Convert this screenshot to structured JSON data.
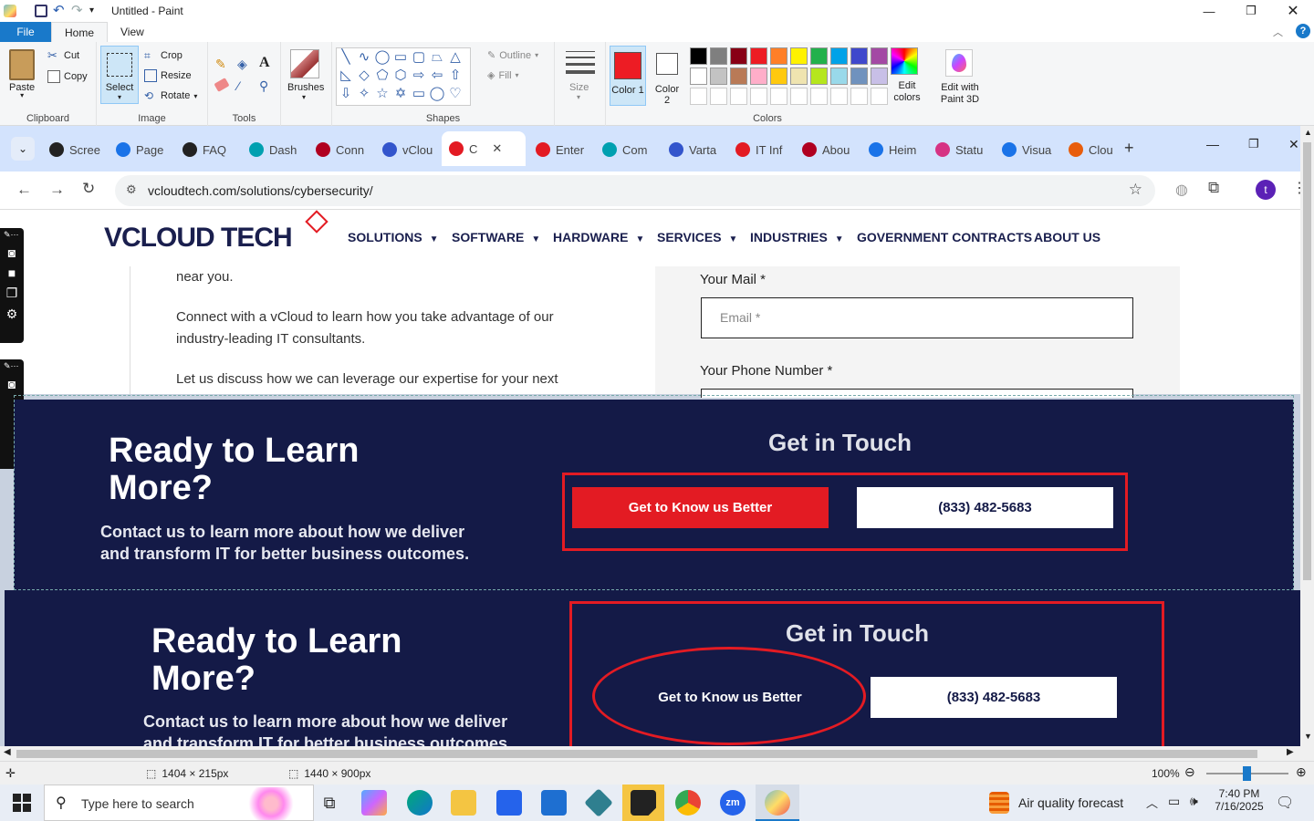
{
  "paint": {
    "window_title": "Untitled - Paint",
    "menu": {
      "file": "File",
      "home": "Home",
      "view": "View"
    },
    "clipboard": {
      "paste": "Paste",
      "cut": "Cut",
      "copy": "Copy",
      "label": "Clipboard"
    },
    "image": {
      "select": "Select",
      "crop": "Crop",
      "resize": "Resize",
      "rotate": "Rotate",
      "label": "Image"
    },
    "tools": {
      "label": "Tools"
    },
    "brushes": {
      "label": "Brushes"
    },
    "shapes": {
      "outline": "Outline",
      "fill": "Fill",
      "label": "Shapes"
    },
    "size": {
      "label": "Size"
    },
    "colors": {
      "color1": "Color 1",
      "color2": "Color 2",
      "edit_colors": "Edit colors",
      "edit_with_paint3d": "Edit with Paint 3D",
      "label": "Colors",
      "color1_value": "#ed1c24",
      "color2_value": "#ffffff",
      "palette_row1": [
        "#000000",
        "#7f7f7f",
        "#880015",
        "#ed1c24",
        "#ff7f27",
        "#fff200",
        "#22b14c",
        "#00a2e8",
        "#3f48cc",
        "#a349a4"
      ],
      "palette_row2": [
        "#ffffff",
        "#c3c3c3",
        "#b97a57",
        "#ffaec9",
        "#ffc90e",
        "#efe4b0",
        "#b5e61d",
        "#99d9ea",
        "#7092be",
        "#c8bfe7"
      ]
    },
    "status": {
      "selection_size": "1404 × 215px",
      "canvas_size": "1440 × 900px",
      "zoom": "100%"
    }
  },
  "browser": {
    "tabs": [
      {
        "label": "Scree",
        "color": "#222"
      },
      {
        "label": "Page",
        "color": "#1a73e8"
      },
      {
        "label": "FAQ",
        "color": "#222"
      },
      {
        "label": "Dash",
        "color": "#00a0b0"
      },
      {
        "label": "Conn",
        "color": "#b00020"
      },
      {
        "label": "vClou",
        "color": "#3355cc"
      },
      {
        "label": "C",
        "color": "#e31b23",
        "active": true
      },
      {
        "label": "Enter",
        "color": "#e31b23"
      },
      {
        "label": "Com",
        "color": "#00a0b0"
      },
      {
        "label": "Varta",
        "color": "#3355cc"
      },
      {
        "label": "IT Inf",
        "color": "#e31b23"
      },
      {
        "label": "Abou",
        "color": "#b00020"
      },
      {
        "label": "Heim",
        "color": "#1a73e8"
      },
      {
        "label": "Statu",
        "color": "#d63384"
      },
      {
        "label": "Visua",
        "color": "#1a73e8"
      },
      {
        "label": "Clou",
        "color": "#e85d0c"
      }
    ],
    "url": "vcloudtech.com/solutions/cybersecurity/",
    "profile_initial": "t"
  },
  "site": {
    "logo_text": "VCLOUD TECH",
    "nav": [
      "SOLUTIONS",
      "SOFTWARE",
      "HARDWARE",
      "SERVICES",
      "INDUSTRIES",
      "GOVERNMENT CONTRACTS",
      "ABOUT US"
    ],
    "para_lines": [
      "near you.",
      "Connect with a vCloud to learn how you take advantage of our",
      "industry-leading IT consultants.",
      "Let us discuss how we can leverage our expertise for your next"
    ],
    "form": {
      "mail_label": "Your Mail *",
      "mail_placeholder": "Email *",
      "phone_label": "Your Phone Number *"
    }
  },
  "cta": {
    "heading_line1": "Ready to Learn",
    "heading_line2": "More?",
    "sub_line1": "Contact us to learn more about how we deliver",
    "sub_line2": "and transform IT for better business outcomes.",
    "get_in_touch": "Get in Touch",
    "know_button": "Get to Know us Better",
    "phone_button": "(833) 482-5683"
  },
  "taskbar": {
    "search_placeholder": "Type here to search",
    "weather": "Air quality forecast",
    "time": "7:40 PM",
    "date": "7/16/2025"
  }
}
